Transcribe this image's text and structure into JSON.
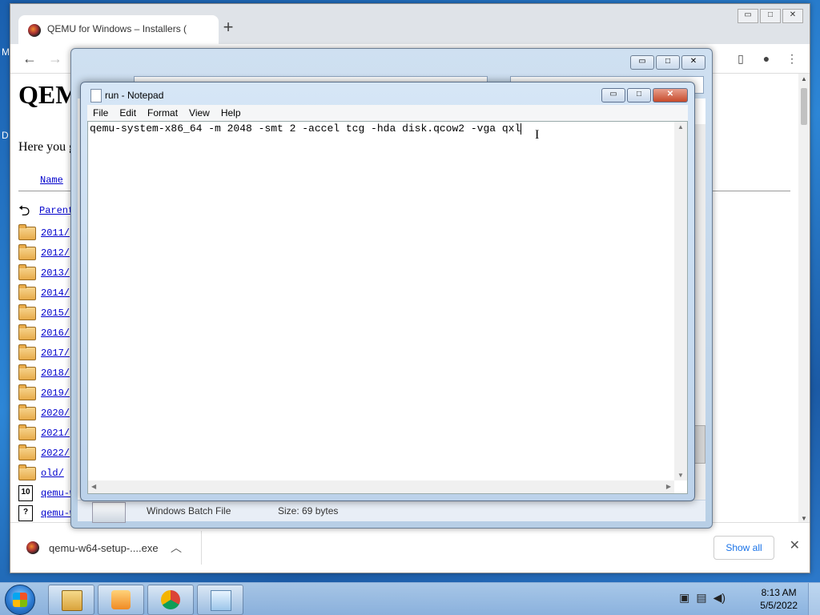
{
  "desktop": {
    "edge_text_1": "M",
    "edge_text_2": "D"
  },
  "chrome": {
    "tab_title": "QEMU for Windows – Installers (",
    "new_tab": "+",
    "back": "←",
    "forward": "→",
    "page_heading": "QEM",
    "intro_text": "Here you g",
    "column_name": "Name",
    "parent_link": "Parent",
    "folders": [
      "2011/",
      "2012/",
      "2013/",
      "2014/",
      "2015/",
      "2016/",
      "2017/",
      "2018/",
      "2019/",
      "2020/",
      "2021/",
      "2022/",
      "old/"
    ],
    "files": [
      "qemu-w",
      "qemu-w"
    ],
    "download_name": "qemu-w64-setup-....exe",
    "show_all": "Show all",
    "close": "✕"
  },
  "explorer": {
    "status_type": "Windows Batch File",
    "status_size": "Size: 69 bytes"
  },
  "notepad": {
    "title": "run - Notepad",
    "menu": [
      "File",
      "Edit",
      "Format",
      "View",
      "Help"
    ],
    "content": "qemu-system-x86_64 -m 2048 -smt 2 -accel tcg -hda disk.qcow2 -vga qxl"
  },
  "taskbar": {
    "time": "8:13 AM",
    "date": "5/5/2022"
  }
}
